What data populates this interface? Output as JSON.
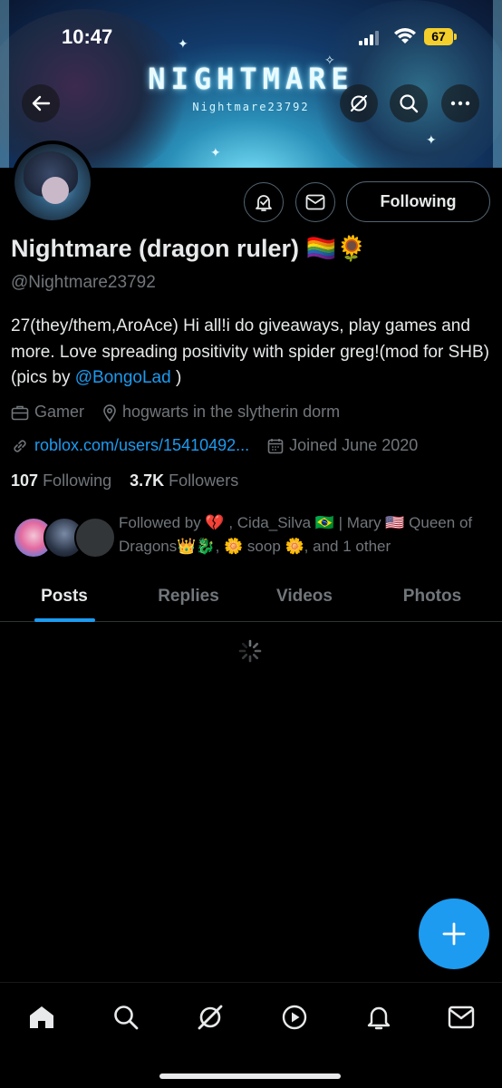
{
  "status_bar": {
    "time": "10:47",
    "battery": "67"
  },
  "banner": {
    "title": "NIGHTMARE",
    "subtitle": "Nightmare23792"
  },
  "profile": {
    "display_name": "Nightmare (dragon ruler) 🏳️‍🌈🌻",
    "handle": "@Nightmare23792",
    "bio_text": "27(they/them,AroAce) Hi all!i do giveaways, play games and more. Love spreading positivity with spider greg!(mod for SHB)(pics by ",
    "bio_mention": "@BongoLad",
    "bio_end": " )",
    "category": "Gamer",
    "location": "hogwarts in the slytherin dorm",
    "website": "roblox.com/users/15410492...",
    "joined": "Joined June 2020",
    "following_count": "107",
    "following_label": "Following",
    "followers_count": "3.7K",
    "followers_label": "Followers",
    "followed_by": "Followed by 💔 , Cida_Silva 🇧🇷 | Mary 🇺🇸 Queen of Dragons👑🐉, 🌼 soop 🌼, and 1 other",
    "follow_button": "Following"
  },
  "tabs": [
    {
      "label": "Posts",
      "active": true
    },
    {
      "label": "Replies",
      "active": false
    },
    {
      "label": "Videos",
      "active": false
    },
    {
      "label": "Photos",
      "active": false
    }
  ],
  "colors": {
    "accent": "#1d9bf0",
    "muted": "#71767b",
    "text": "#e7e9ea",
    "background": "#000000"
  },
  "nav_icons": [
    "home-icon",
    "search-icon",
    "grok-icon",
    "video-icon",
    "notifications-icon",
    "messages-icon"
  ]
}
